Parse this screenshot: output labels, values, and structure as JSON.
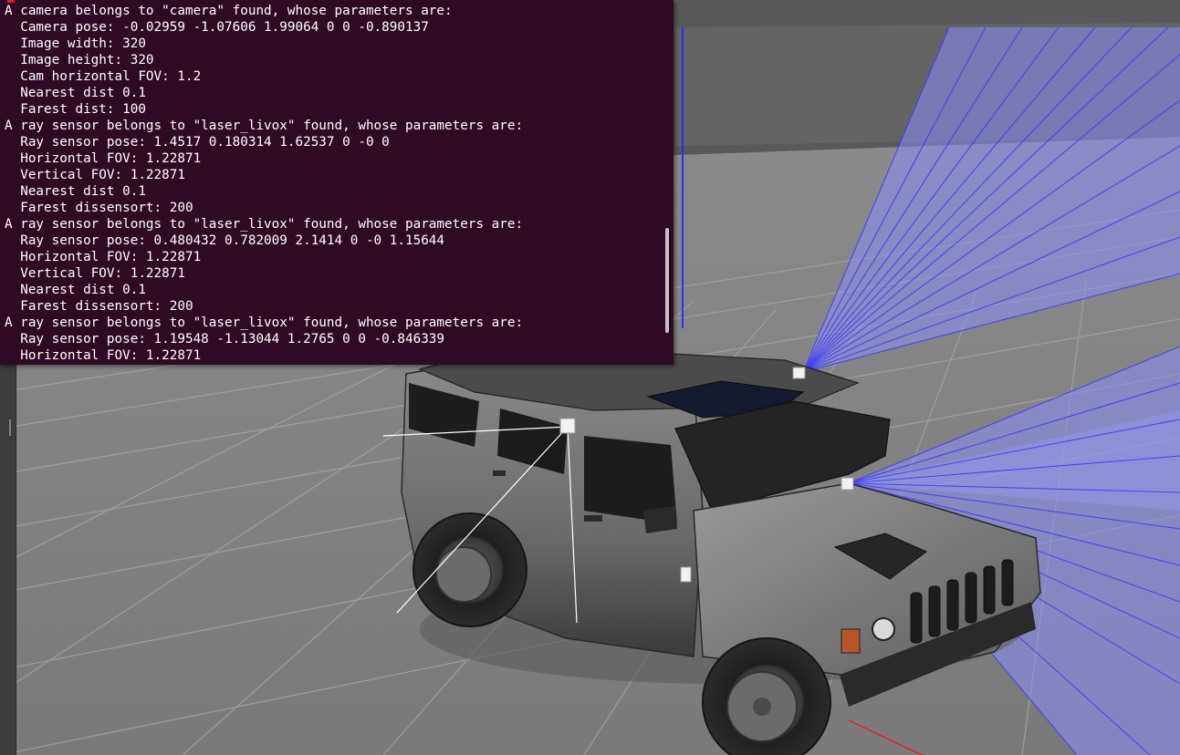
{
  "terminal": {
    "lines": [
      "A camera belongs to \"camera\" found, whose parameters are:",
      "  Camera pose: -0.02959 -1.07606 1.99064 0 0 -0.890137",
      "  Image width: 320",
      "  Image height: 320",
      "  Cam horizontal FOV: 1.2",
      "  Nearest dist 0.1",
      "  Farest dist: 100",
      "A ray sensor belongs to \"laser_livox\" found, whose parameters are:",
      "  Ray sensor pose: 1.4517 0.180314 1.62537 0 -0 0",
      "  Horizontal FOV: 1.22871",
      "  Vertical FOV: 1.22871",
      "  Nearest dist 0.1",
      "  Farest dissensort: 200",
      "A ray sensor belongs to \"laser_livox\" found, whose parameters are:",
      "  Ray sensor pose: 0.480432 0.782009 2.1414 0 -0 1.15644",
      "  Horizontal FOV: 1.22871",
      "  Vertical FOV: 1.22871",
      "  Nearest dist 0.1",
      "  Farest dissensort: 200",
      "A ray sensor belongs to \"laser_livox\" found, whose parameters are:",
      "  Ray sensor pose: 1.19548 -1.13044 1.2765 0 0 -0.846339",
      "  Horizontal FOV: 1.22871"
    ],
    "background": "#300a24",
    "text_color": "#ffffff"
  },
  "scene": {
    "ground_color": "#7f7f7f",
    "grid_color": "#9a9a9a",
    "sky_color": "#5a5a5a",
    "ray_color": "#3b3bff",
    "ray_fill": "#8c8cf5",
    "vehicle_body_color": "#6e6e6e",
    "vehicle_window_color": "#1c1c1c"
  }
}
